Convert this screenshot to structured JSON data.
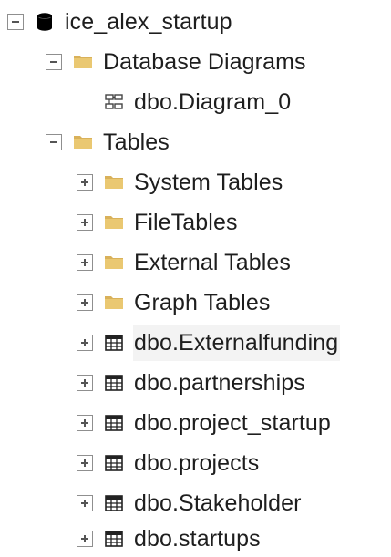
{
  "tree": {
    "root": {
      "label": "ice_alex_startup",
      "icon": "database-icon",
      "toggle": "expanded"
    },
    "database_diagrams": {
      "label": "Database Diagrams",
      "icon": "folder-icon",
      "toggle": "expanded"
    },
    "diagram_0": {
      "label": "dbo.Diagram_0",
      "icon": "diagram-icon"
    },
    "tables": {
      "label": "Tables",
      "icon": "folder-icon",
      "toggle": "expanded"
    },
    "table_folders": [
      {
        "label": "System Tables",
        "icon": "folder-icon",
        "toggle": "collapsed"
      },
      {
        "label": "FileTables",
        "icon": "folder-icon",
        "toggle": "collapsed"
      },
      {
        "label": "External Tables",
        "icon": "folder-icon",
        "toggle": "collapsed"
      },
      {
        "label": "Graph Tables",
        "icon": "folder-icon",
        "toggle": "collapsed"
      }
    ],
    "table_items": [
      {
        "label": "dbo.Externalfunding",
        "icon": "table-icon",
        "toggle": "collapsed",
        "selected": true
      },
      {
        "label": "dbo.partnerships",
        "icon": "table-icon",
        "toggle": "collapsed"
      },
      {
        "label": "dbo.project_startup",
        "icon": "table-icon",
        "toggle": "collapsed"
      },
      {
        "label": "dbo.projects",
        "icon": "table-icon",
        "toggle": "collapsed"
      },
      {
        "label": "dbo.Stakeholder",
        "icon": "table-icon",
        "toggle": "collapsed"
      },
      {
        "label": "dbo.startups",
        "icon": "table-icon",
        "toggle": "collapsed"
      }
    ]
  }
}
